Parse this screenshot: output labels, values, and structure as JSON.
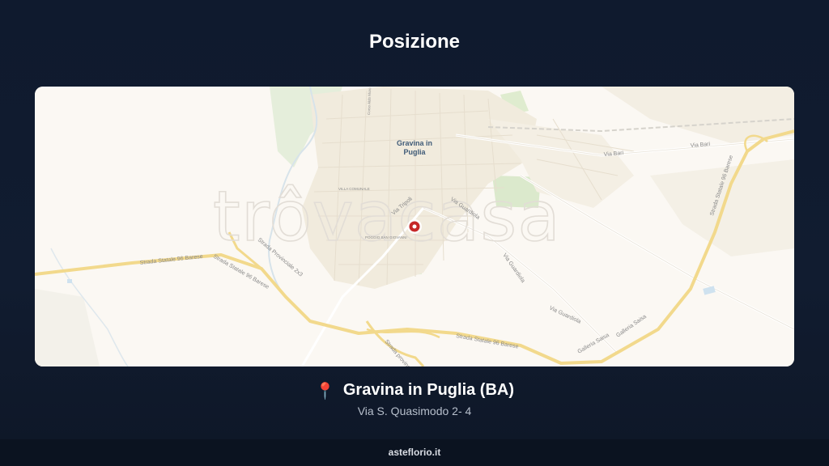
{
  "header": {
    "title": "Posizione"
  },
  "map": {
    "city_label_line1": "Gravina in",
    "city_label_line2": "Puglia",
    "watermark": "trôvacasa",
    "labels": {
      "via_bari_1": "Via Bari",
      "via_bari_2": "Via Bari",
      "via_tripoli": "Via Tripoli",
      "via_guardiola_1": "Via Guardiola",
      "via_guardiola_2": "Via Guardiola",
      "via_guardiola_3": "Via Guardiola",
      "ss96_west": "Strada Statale 96 Barese",
      "ss96_west2": "Strada Statale 96 Barese",
      "ss96_south": "Strada Statale 96 Barese",
      "ss96_east": "Strada Statale 96 Barese",
      "sp2x3": "Strada Provinciale 2x3",
      "galleria_1": "Galleria Saisa",
      "galleria_2": "Galleria Saisa",
      "villa_comunale": "VILLA COMUNALE",
      "poggio": "POGGIO SAN GIOVANNI",
      "corso": "Corso Aldo Moro",
      "strada_prov": "Strada provinciale"
    },
    "colors": {
      "pin": "#c62828",
      "highway": "#f2d98c",
      "land": "#fbf8f3",
      "green": "#dfeacd"
    }
  },
  "location": {
    "pin_icon": "📍",
    "name": "Gravina in Puglia (BA)",
    "address": "Via S. Quasimodo 2- 4"
  },
  "footer": {
    "brand": "asteflorio.it"
  }
}
